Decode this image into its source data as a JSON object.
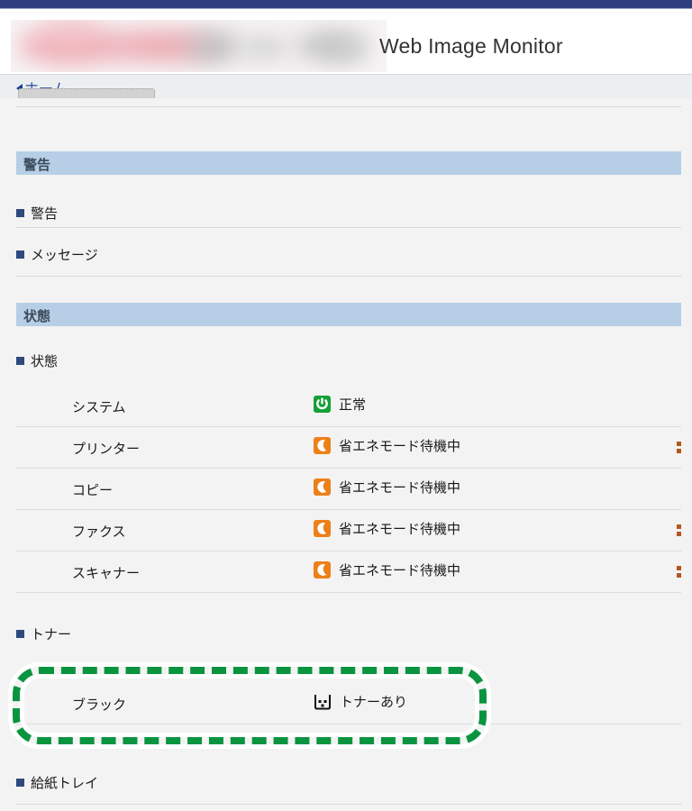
{
  "header": {
    "app_title": "Web Image Monitor",
    "logo_alt": "redacted-brand-logo"
  },
  "nav": {
    "home_label": "ホーム"
  },
  "sections": [
    {
      "id": "warning",
      "header": "警告",
      "groups": [
        {
          "label": "警告"
        },
        {
          "label": "メッセージ"
        }
      ]
    },
    {
      "id": "status",
      "header": "状態",
      "groups": [
        {
          "label": "状態"
        },
        {
          "label": "トナー"
        },
        {
          "label": "給紙トレイ"
        }
      ]
    }
  ],
  "status_rows": [
    {
      "name": "システム",
      "icon": "power-green-icon",
      "state": "正常"
    },
    {
      "name": "プリンター",
      "icon": "moon-orange-icon",
      "state": "省エネモード待機中"
    },
    {
      "name": "コピー",
      "icon": "moon-orange-icon",
      "state": "省エネモード待機中"
    },
    {
      "name": "ファクス",
      "icon": "moon-orange-icon",
      "state": "省エネモード待機中"
    },
    {
      "name": "スキャナー",
      "icon": "moon-orange-icon",
      "state": "省エネモード待機中"
    }
  ],
  "toner_rows": [
    {
      "name": "ブラック",
      "icon": "toner-level-icon",
      "state": "トナーあり"
    }
  ],
  "annotation": {
    "shape": "dashed-rounded-rect",
    "color": "#0a9440",
    "target": "toner-black-row"
  },
  "colors": {
    "topbar": "#2e3f7f",
    "section_header_bg": "#b6cfe6",
    "bullet": "#2e4a7d",
    "link": "#2b4f9c",
    "status_ok": "#15a037",
    "status_sleep": "#ec8019",
    "highlight": "#0a9440"
  }
}
